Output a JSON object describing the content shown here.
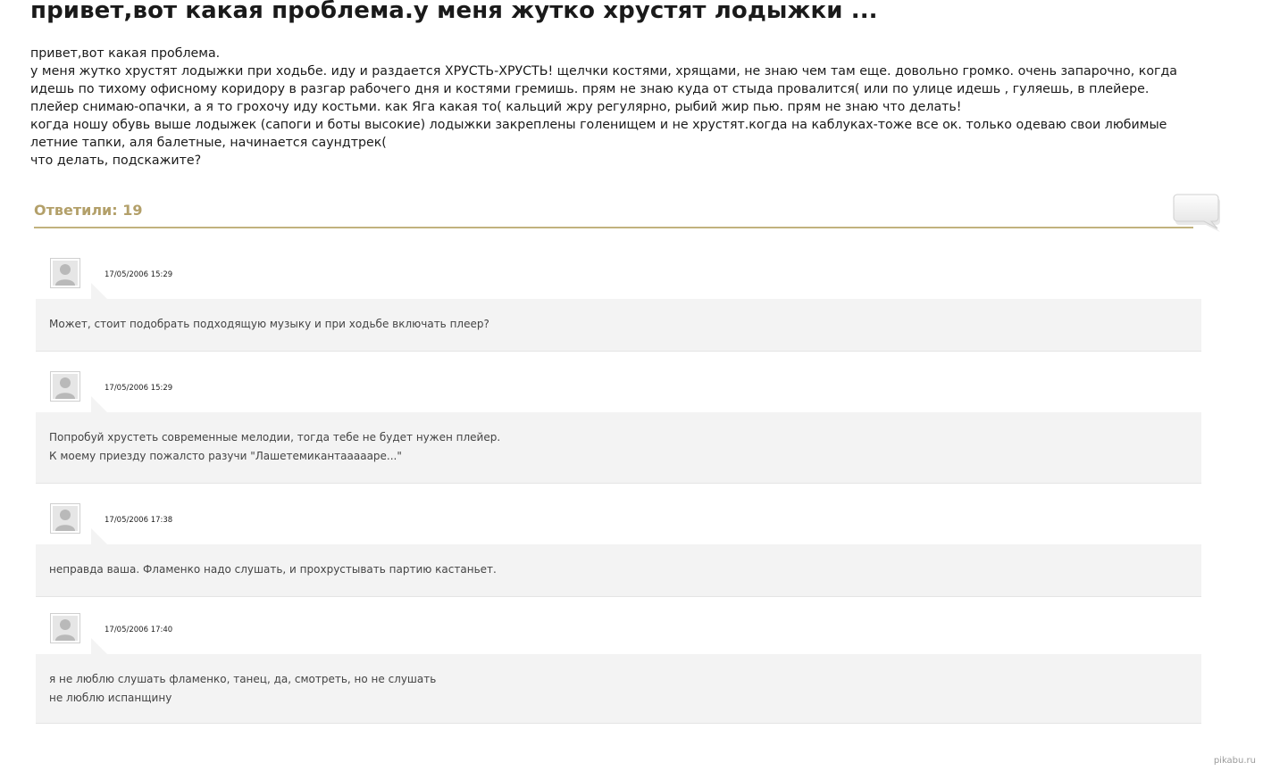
{
  "page": {
    "title": "привет,вот какая проблема.у меня жутко хрустят лодыжки ..."
  },
  "question": {
    "lines": [
      "привет,вот какая проблема.",
      "у меня жутко хрустят лодыжки при ходьбе. иду и раздается ХРУСТЬ-ХРУСТЬ! щелчки костями, хрящами, не знаю чем там еще. довольно громко. очень запарочно, когда",
      "идешь по тихому офисному коридору в разгар рабочего дня и костями гремишь. прям не знаю куда от стыда провалится( или по улице идешь , гуляешь, в плейере.",
      "плейер снимаю-опачки, а я то грохочу иду костьми. как Яга какая то( кальций жру регулярно, рыбий жир пью. прям не знаю что делать!",
      "когда ношу обувь выше лодыжек (сапоги и боты высокие) лодыжки закреплены голенищем и не хрустят.когда на каблуках-тоже все ок. только одеваю свои любимые",
      "летние тапки, аля балетные, начинается саундтрек(",
      "что делать, подскажите?"
    ]
  },
  "answers": {
    "header": "Ответили: 19",
    "accent_color": "#b3a06a"
  },
  "comments": [
    {
      "date": "17/05/2006 15:29",
      "lines": [
        "Может, стоит подобрать подходящую музыку и при ходьбе включать плеер?"
      ]
    },
    {
      "date": "17/05/2006 15:29",
      "lines": [
        "Попробуй хрустеть современные мелодии, тогда тебе не будет нужен плейер.",
        "К моему приезду пожалсто разучи \"Лашетемикантаааааре...\""
      ]
    },
    {
      "date": "17/05/2006 17:38",
      "lines": [
        "неправда ваша. Фламенко надо слушать, и прохрустывать партию кастаньет."
      ]
    },
    {
      "date": "17/05/2006 17:40",
      "lines": [
        "я не люблю слушать фламенко, танец, да, смотреть, но не слушать",
        "не люблю испанщину"
      ]
    }
  ],
  "icons": {
    "avatar": "default-user-avatar-icon",
    "answers": "speech-bubble-icon"
  },
  "watermark": "pikabu.ru"
}
